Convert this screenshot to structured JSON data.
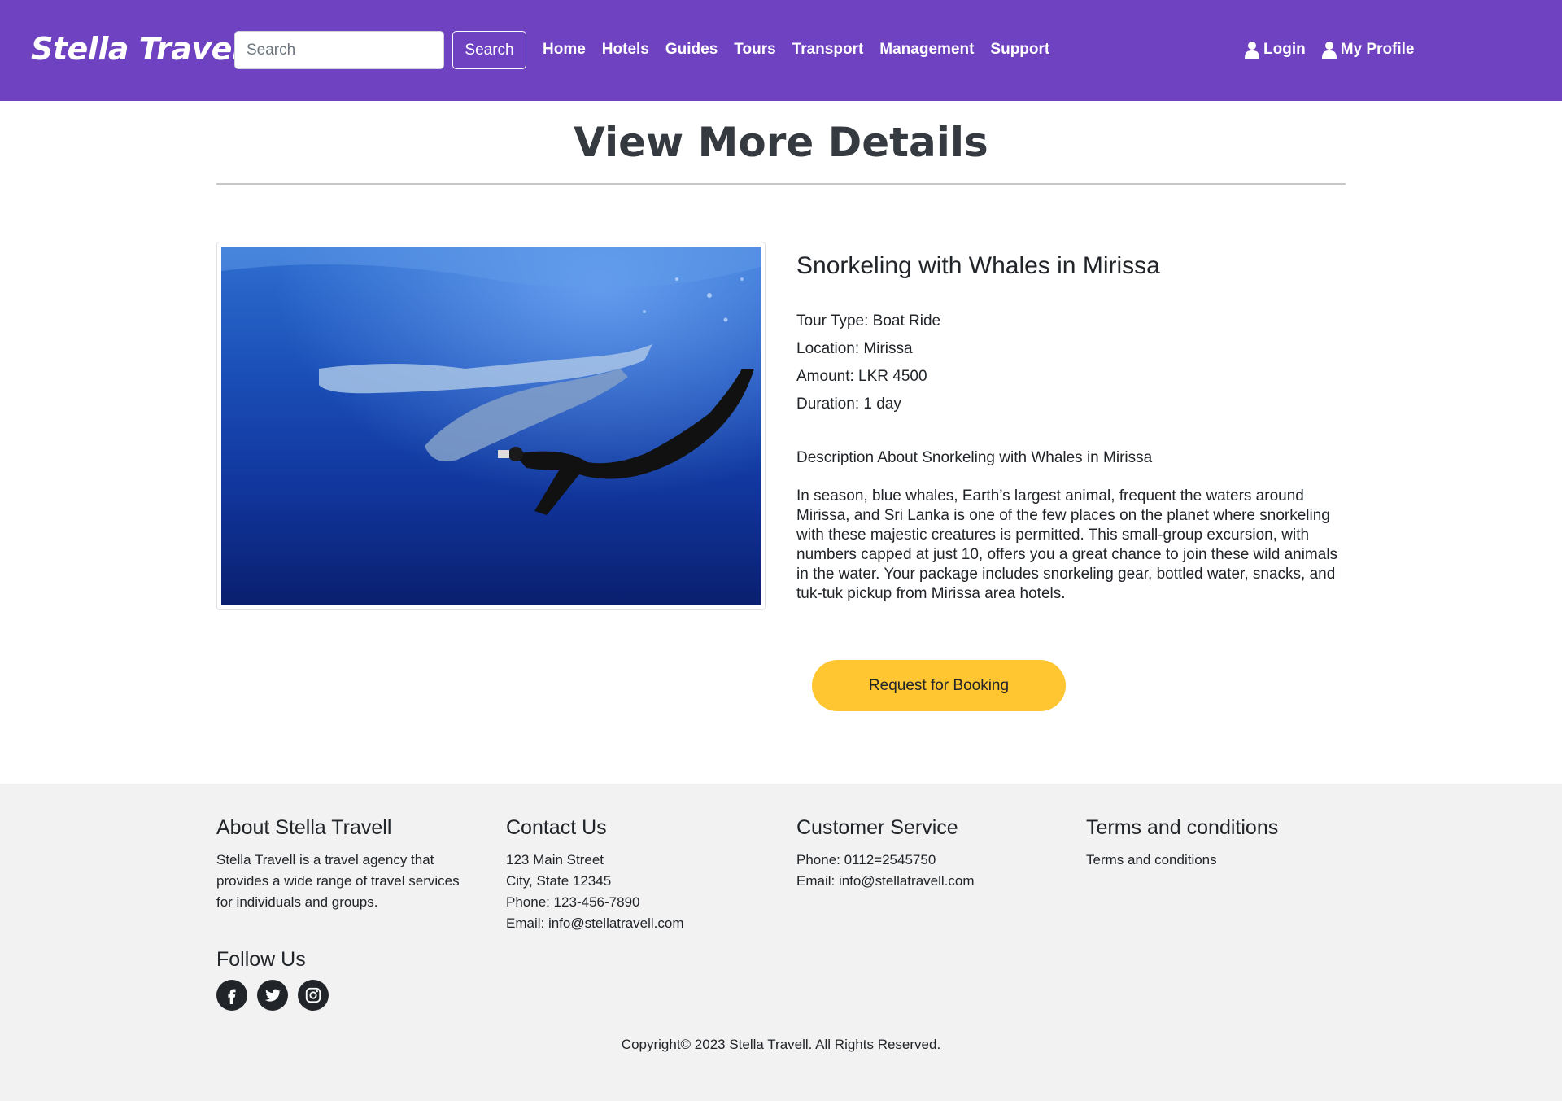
{
  "navbar": {
    "brand": "Stella Travel",
    "search_placeholder": "Search",
    "search_button": "Search",
    "links": [
      "Home",
      "Hotels",
      "Guides",
      "Tours",
      "Transport",
      "Management",
      "Support"
    ],
    "login": "Login",
    "profile": "My Profile",
    "background_color": "#6f42c1"
  },
  "page": {
    "title": "View More Details"
  },
  "tour": {
    "name": "Snorkeling with Whales in Mirissa",
    "tour_type": "Tour Type: Boat Ride",
    "location": "Location: Mirissa",
    "amount": "Amount: LKR 4500",
    "duration": "Duration: 1 day",
    "description_heading": "Description About Snorkeling with Whales in Mirissa",
    "description": "In season, blue whales, Earth’s largest animal, frequent the waters around Mirissa, and Sri Lanka is one of the few places on the planet where snorkeling with these majestic creatures is permitted. This small-group excursion, with numbers capped at just 10, offers you a great chance to join these wild animals in the water. Your package includes snorkeling gear, bottled water, snacks, and tuk-tuk pickup from Mirissa area hotels.",
    "booking_button": "Request for Booking",
    "booking_color": "#ffc631"
  },
  "footer": {
    "about": {
      "heading": "About Stella Travell",
      "lines": [
        "Stella Travell is a travel agency that",
        "provides a wide range of travel services",
        "for individuals and groups."
      ]
    },
    "contact": {
      "heading": "Contact Us",
      "lines": [
        "123 Main Street",
        "City, State 12345",
        "Phone: 123-456-7890",
        "Email: info@stellatravell.com"
      ]
    },
    "service": {
      "heading": "Customer Service",
      "lines": [
        "Phone: 0112=2545750",
        "Email: info@stellatravell.com"
      ]
    },
    "terms": {
      "heading": "Terms and conditions",
      "lines": [
        "Terms and conditions"
      ]
    },
    "follow_heading": "Follow Us",
    "social_icons": [
      "facebook-icon",
      "twitter-icon",
      "instagram-icon"
    ],
    "copyright": "Copyright© 2023 Stella Travell. All Rights Reserved."
  }
}
